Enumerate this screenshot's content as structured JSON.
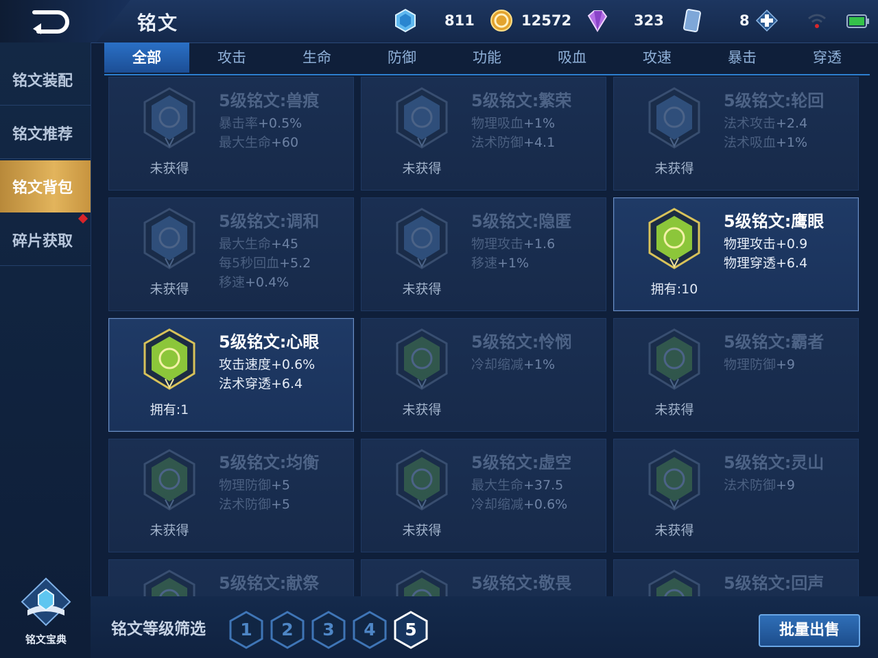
{
  "header": {
    "title": "铭文",
    "resources": [
      {
        "icon": "diamond-gem-icon",
        "value": "811"
      },
      {
        "icon": "gold-coin-icon",
        "value": "12572"
      },
      {
        "icon": "crystal-icon",
        "value": "323"
      },
      {
        "icon": "inscription-fragment-card-icon",
        "value": "8"
      }
    ]
  },
  "sidebar": {
    "items": [
      {
        "label": "铭文装配"
      },
      {
        "label": "铭文推荐"
      },
      {
        "label": "铭文背包"
      },
      {
        "label": "碎片获取"
      }
    ],
    "active_index": 2,
    "codex_label": "铭文宝典"
  },
  "tabs": [
    {
      "label": "全部"
    },
    {
      "label": "攻击"
    },
    {
      "label": "生命"
    },
    {
      "label": "防御"
    },
    {
      "label": "功能"
    },
    {
      "label": "吸血"
    },
    {
      "label": "攻速"
    },
    {
      "label": "暴击"
    },
    {
      "label": "穿透"
    }
  ],
  "active_tab": 0,
  "cards": [
    {
      "name": "5级铭文:兽痕",
      "stats": [
        {
          "k": "暴击率",
          "v": "+0.5%"
        },
        {
          "k": "最大生命",
          "v": "+60"
        }
      ],
      "status": "未获得",
      "owned": false,
      "color": "#4a78b0"
    },
    {
      "name": "5级铭文:繁荣",
      "stats": [
        {
          "k": "物理吸血",
          "v": "+1%"
        },
        {
          "k": "法术防御",
          "v": "+4.1"
        }
      ],
      "status": "未获得",
      "owned": false,
      "color": "#4a78b0"
    },
    {
      "name": "5级铭文:轮回",
      "stats": [
        {
          "k": "法术攻击",
          "v": "+2.4"
        },
        {
          "k": "法术吸血",
          "v": "+1%"
        }
      ],
      "status": "未获得",
      "owned": false,
      "color": "#4a78b0"
    },
    {
      "name": "5级铭文:调和",
      "stats": [
        {
          "k": "最大生命",
          "v": "+45"
        },
        {
          "k": "每5秒回血",
          "v": "+5.2"
        },
        {
          "k": "移速",
          "v": "+0.4%"
        }
      ],
      "status": "未获得",
      "owned": false,
      "color": "#4a78b0"
    },
    {
      "name": "5级铭文:隐匿",
      "stats": [
        {
          "k": "物理攻击",
          "v": "+1.6"
        },
        {
          "k": "移速",
          "v": "+1%"
        }
      ],
      "status": "未获得",
      "owned": false,
      "color": "#4a78b0"
    },
    {
      "name": "5级铭文:鹰眼",
      "stats": [
        {
          "k": "物理攻击",
          "v": "+0.9"
        },
        {
          "k": "物理穿透",
          "v": "+6.4"
        }
      ],
      "status": "拥有:10",
      "owned": true,
      "color": "#8cc63a"
    },
    {
      "name": "5级铭文:心眼",
      "stats": [
        {
          "k": "攻击速度",
          "v": "+0.6%"
        },
        {
          "k": "法术穿透",
          "v": "+6.4"
        }
      ],
      "status": "拥有:1",
      "owned": true,
      "color": "#8cc63a"
    },
    {
      "name": "5级铭文:怜悯",
      "stats": [
        {
          "k": "冷却缩减",
          "v": "+1%"
        }
      ],
      "status": "未获得",
      "owned": false,
      "color": "#4f8a4a"
    },
    {
      "name": "5级铭文:霸者",
      "stats": [
        {
          "k": "物理防御",
          "v": "+9"
        }
      ],
      "status": "未获得",
      "owned": false,
      "color": "#4f8a4a"
    },
    {
      "name": "5级铭文:均衡",
      "stats": [
        {
          "k": "物理防御",
          "v": "+5"
        },
        {
          "k": "法术防御",
          "v": "+5"
        }
      ],
      "status": "未获得",
      "owned": false,
      "color": "#4f8a4a"
    },
    {
      "name": "5级铭文:虚空",
      "stats": [
        {
          "k": "最大生命",
          "v": "+37.5"
        },
        {
          "k": "冷却缩减",
          "v": "+0.6%"
        }
      ],
      "status": "未获得",
      "owned": false,
      "color": "#4f8a4a"
    },
    {
      "name": "5级铭文:灵山",
      "stats": [
        {
          "k": "法术防御",
          "v": "+9"
        }
      ],
      "status": "未获得",
      "owned": false,
      "color": "#4f8a4a"
    },
    {
      "name": "5级铭文:献祭",
      "stats": [],
      "status": "",
      "owned": false,
      "color": "#4f8a4a"
    },
    {
      "name": "5级铭文:敬畏",
      "stats": [],
      "status": "",
      "owned": false,
      "color": "#4f8a4a"
    },
    {
      "name": "5级铭文:回声",
      "stats": [],
      "status": "",
      "owned": false,
      "color": "#4f8a4a"
    }
  ],
  "footer": {
    "filter_label": "铭文等级筛选",
    "levels": [
      "1",
      "2",
      "3",
      "4",
      "5"
    ],
    "active_level": 4,
    "sell_label": "批量出售"
  }
}
